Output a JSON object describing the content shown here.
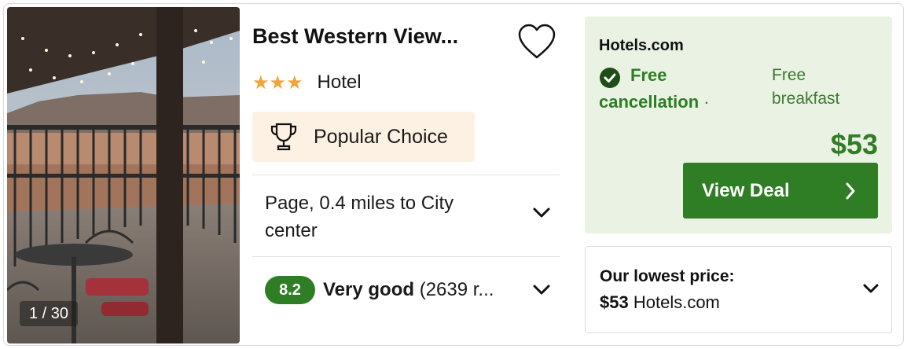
{
  "photo": {
    "counter": "1 / 30"
  },
  "hotel": {
    "name": "Best Western View...",
    "stars": 3,
    "star_glyph": "★★★",
    "type": "Hotel",
    "badge": "Popular Choice",
    "location": "Page, 0.4 miles to City center",
    "rating": {
      "score": "8.2",
      "label": "Very good",
      "reviews": "(2639 r..."
    }
  },
  "deal": {
    "provider": "Hotels.com",
    "free_cancellation": "Free cancellation",
    "separator": "·",
    "breakfast": "Free breakfast",
    "price": "$53",
    "button_label": "View Deal"
  },
  "lowest": {
    "label": "Our lowest price:",
    "price": "$53",
    "provider": "Hotels.com"
  },
  "colors": {
    "accent_green": "#2f7d25",
    "deal_bg": "#eaf3e3",
    "badge_bg": "#fdf1e4",
    "star": "#f2a33a"
  }
}
